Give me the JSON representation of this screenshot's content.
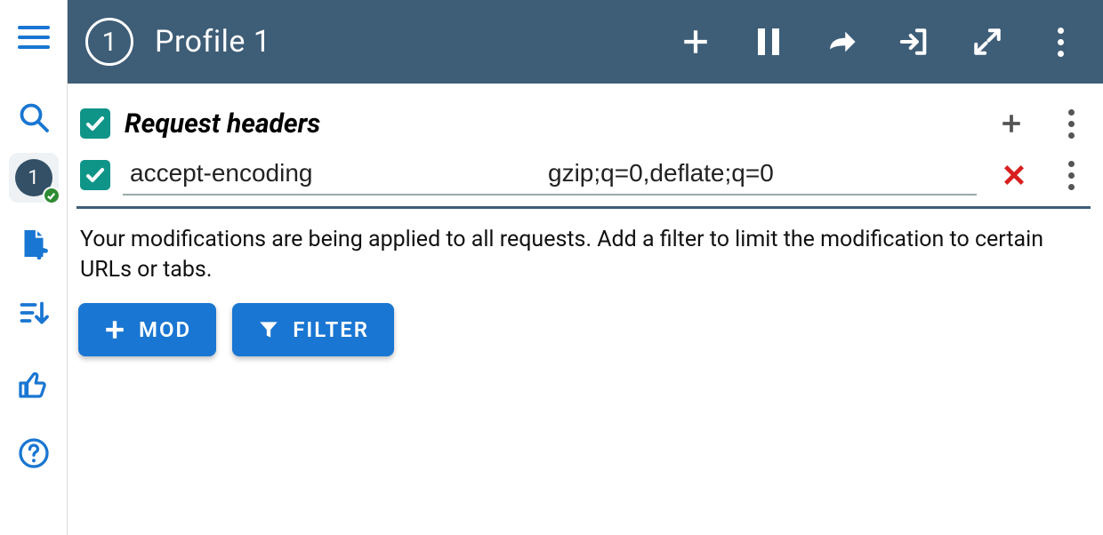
{
  "header": {
    "profile_number": "1",
    "profile_title": "Profile 1"
  },
  "rail": {
    "profile_number": "1"
  },
  "section": {
    "title": "Request headers"
  },
  "headers": [
    {
      "name": "accept-encoding",
      "value": "gzip;q=0,deflate;q=0"
    }
  ],
  "notice": "Your modifications are being applied to all requests. Add a filter to limit the modification to certain URLs or tabs.",
  "buttons": {
    "mod": "MOD",
    "filter": "FILTER"
  }
}
